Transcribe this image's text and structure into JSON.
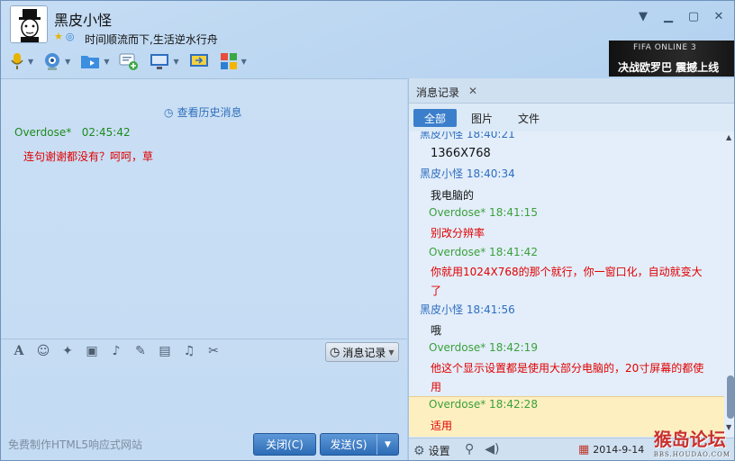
{
  "header": {
    "contact_name": "黑皮小怪",
    "signature": "时间顺流而下,生活逆水行舟",
    "ad": {
      "logo_text": "FIFA ONLINE 3",
      "slogan": "决战欧罗巴 震撼上线"
    }
  },
  "toolbar": {
    "icons": [
      "voice-call-icon",
      "video-call-icon",
      "file-transfer-icon",
      "group-chat-icon",
      "remote-desktop-icon",
      "screen-share-icon",
      "apps-icon"
    ]
  },
  "chat": {
    "history_link": "查看历史消息",
    "messages": [
      {
        "sender": "Overdose*",
        "time": "02:45:42",
        "text": "连句谢谢都没有？呵呵，草"
      }
    ],
    "history_button": "消息记录",
    "footer_text": "免费制作HTML5响应式网站",
    "close_button": "关闭(C)",
    "send_button": "发送(S)"
  },
  "history": {
    "tab_title": "消息记录",
    "filters": [
      "全部",
      "图片",
      "文件"
    ],
    "active_filter": "全部",
    "entries": [
      {
        "type": "sender-other",
        "text": "黑皮小怪 18:40:21"
      },
      {
        "type": "text-black",
        "text": "1366X768"
      },
      {
        "type": "sender-other",
        "text": "黑皮小怪 18:40:34"
      },
      {
        "type": "text-black",
        "text": "我电脑的"
      },
      {
        "type": "sender-me",
        "text": "Overdose* 18:41:15"
      },
      {
        "type": "text-red",
        "text": "别改分辨率"
      },
      {
        "type": "sender-me",
        "text": "Overdose* 18:41:42"
      },
      {
        "type": "text-red",
        "text": "你就用1024X768的那个就行，你一窗口化，自动就变大了"
      },
      {
        "type": "sender-other",
        "text": "黑皮小怪 18:41:56"
      },
      {
        "type": "text-black",
        "text": "哦"
      },
      {
        "type": "sender-me",
        "text": "Overdose* 18:42:19"
      },
      {
        "type": "text-red",
        "text": "他这个显示设置都是使用大部分电脑的，20寸屏幕的都使用"
      },
      {
        "type": "sender-me",
        "text": "Overdose* 18:42:28"
      },
      {
        "type": "text-red",
        "text": "适用"
      }
    ],
    "settings_label": "设置",
    "date": "2014-9-14"
  },
  "watermark": {
    "title": "猴岛论坛",
    "url": "BBS.HOUDAO.COM"
  },
  "colors": {
    "accent": "#3b7fcc",
    "sender_other": "#2e6dc0",
    "sender_me": "#3ba03b",
    "message_red": "#e00000",
    "highlight": "#fdefc0"
  }
}
